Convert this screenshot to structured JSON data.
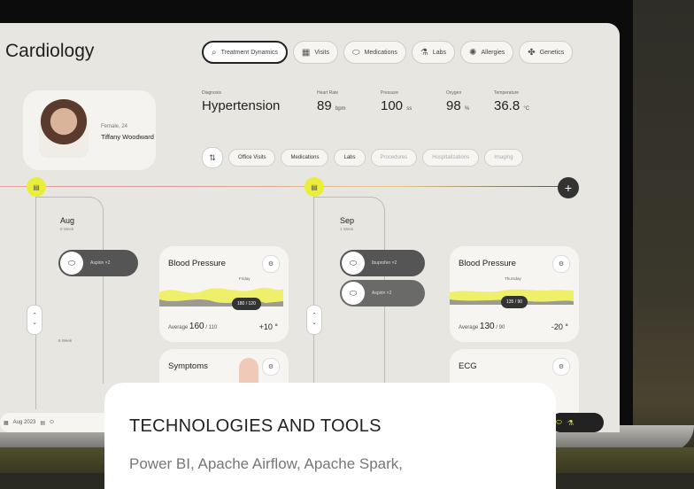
{
  "app": {
    "title": "Cardiology"
  },
  "nav_tabs": [
    {
      "label": "Treatment Dynamics",
      "icon": "search-icon"
    },
    {
      "label": "Visits",
      "icon": "calendar-icon"
    },
    {
      "label": "Medications",
      "icon": "pill-icon"
    },
    {
      "label": "Labs",
      "icon": "flask-icon"
    },
    {
      "label": "Allergies",
      "icon": "virus-icon"
    },
    {
      "label": "Genetics",
      "icon": "dna-icon"
    }
  ],
  "patient": {
    "sex_age": "Female, 24",
    "name": "Tiffany Woodward"
  },
  "stats": [
    {
      "label": "Diagnosis",
      "value": "Hypertension",
      "unit": ""
    },
    {
      "label": "Heart Rate",
      "value": "89",
      "unit": "bpm"
    },
    {
      "label": "Pressure",
      "value": "100",
      "unit": "ss"
    },
    {
      "label": "Oxygen",
      "value": "98",
      "unit": "%"
    },
    {
      "label": "Temperature",
      "value": "36.8",
      "unit": "°C"
    }
  ],
  "sub_tabs": [
    {
      "label": "Office Visits",
      "dim": false
    },
    {
      "label": "Medications",
      "dim": false
    },
    {
      "label": "Labs",
      "dim": false
    },
    {
      "label": "Procedures",
      "dim": true
    },
    {
      "label": "Hospitalizations",
      "dim": true
    },
    {
      "label": "Imaging",
      "dim": true
    }
  ],
  "timeline": {
    "aug": {
      "month": "Aug",
      "weeks": "8 Week"
    },
    "sep": {
      "month": "Sep",
      "weeks": "1 Week"
    },
    "week_label": "6 Week",
    "aug_pill": "Aspirin ×2",
    "sep_pill1": "Ibuprofen ×2",
    "sep_pill2": "Aspirin ×2"
  },
  "cards": {
    "bp_aug": {
      "title": "Blood Pressure",
      "tag": "Friday",
      "chip": "180 / 120",
      "avg_label": "Average",
      "avg": "160",
      "avg_unit": "/ 110",
      "delta": "+10 °"
    },
    "symptoms": {
      "title": "Symptoms"
    },
    "bp_sep": {
      "title": "Blood Pressure",
      "tag": "Thursday",
      "chip": "135 / 90",
      "avg_label": "Average",
      "avg": "130",
      "avg_unit": "/ 90",
      "delta": "-20 °"
    },
    "ecg": {
      "title": "ECG"
    }
  },
  "dock": {
    "date": "Aug 2023"
  },
  "overlay": {
    "title": "TECHNOLOGIES AND TOOLS",
    "body": "Power BI, Apache Airflow, Apache Spark,"
  }
}
